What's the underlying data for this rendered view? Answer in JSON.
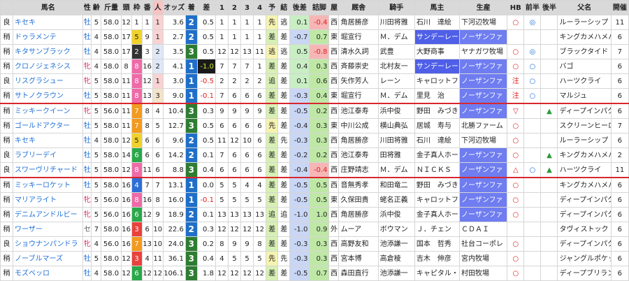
{
  "headers": [
    "馬名",
    "性",
    "齢",
    "斤量",
    "頭",
    "枠",
    "番",
    "人",
    "オッズ",
    "着",
    "差",
    "1",
    "2",
    "3",
    "4",
    "予",
    "結",
    "後差",
    "詰脚",
    "屋",
    "厩舎",
    "騎手",
    "馬主",
    "生産",
    "HB",
    "前半",
    "後半",
    "父名",
    "開催"
  ],
  "rows": [
    {
      "c": "良",
      "n": "キセキ",
      "s": "牡",
      "a": "5",
      "kg": "58.0",
      "h": "12",
      "w": "1",
      "u": "1",
      "p": "1",
      "o": "3.6",
      "f": "2",
      "d": "0.5",
      "c1": "1",
      "c2": "1",
      "c3": "1",
      "c4": "1",
      "y": "先",
      "k": "逃",
      "kd": "0.1",
      "tz": "-0.4",
      "ya": "西",
      "tr": "角居勝彦",
      "jk": "川田将雅",
      "ow": "石川　達絵",
      "br": "下河辺牧場",
      "hb": "○",
      "zh": "◎",
      "kh": "",
      "sire": "ルーラーシップ",
      "kai": "11"
    },
    {
      "c": "稍",
      "n": "ドゥラメンテ",
      "s": "牡",
      "a": "4",
      "kg": "58.0",
      "h": "17",
      "w": "5",
      "u": "9",
      "p": "1",
      "o": "2.7",
      "f": "2",
      "d": "0.5",
      "c1": "1",
      "c2": "1",
      "c3": "1",
      "c4": "1",
      "y": "差",
      "k": "差",
      "kd": "-0.7",
      "tz": "0.7",
      "ya": "東",
      "tr": "堀宣行",
      "jk": "Ｍ．デム",
      "ow": "サンデーレー",
      "br": "ノーザンファ",
      "hb": "",
      "zh": "",
      "kh": "",
      "sire": "キングカメハメハ",
      "kai": "6"
    },
    {
      "c": "稍",
      "n": "キタサンブラック",
      "s": "牡",
      "a": "4",
      "kg": "58.0",
      "h": "17",
      "w": "2",
      "u": "3",
      "p": "2",
      "o": "3.5",
      "f": "3",
      "d": "0.5",
      "c1": "12",
      "c2": "12",
      "c3": "13",
      "c4": "11",
      "y": "逃",
      "k": "逃",
      "kd": "0.5",
      "tz": "-0.8",
      "ya": "西",
      "tr": "清水久詞",
      "jk": "武豊",
      "ow": "大野商事",
      "br": "ヤナガワ牧場",
      "hb": "○",
      "zh": "◎",
      "kh": "",
      "sire": "ブラックタイド",
      "kai": "7"
    },
    {
      "c": "稍",
      "n": "クロノジェネシス",
      "s": "牝",
      "a": "4",
      "kg": "58.0",
      "h": "8",
      "w": "8",
      "u": "16",
      "p": "2",
      "o": "4.1",
      "f": "1",
      "d": "-1.0",
      "c1": "7",
      "c2": "7",
      "c3": "7",
      "c4": "1",
      "y": "差",
      "k": "差",
      "kd": "0.4",
      "tz": "0.3",
      "ya": "西",
      "tr": "斉藤崇史",
      "jk": "北村友一",
      "ow": "サンデーレー",
      "br": "ノーザンファ",
      "hb": "○",
      "zh": "○",
      "kh": "",
      "sire": "バゴ",
      "kai": "6"
    },
    {
      "c": "良",
      "n": "リスグラシュー",
      "s": "牝",
      "a": "5",
      "kg": "58.0",
      "h": "11",
      "w": "8",
      "u": "12",
      "p": "1",
      "o": "3.0",
      "f": "1",
      "d": "-0.5",
      "c1": "2",
      "c2": "2",
      "c3": "2",
      "c4": "2",
      "y": "追",
      "k": "差",
      "kd": "0.1",
      "tz": "0.6",
      "ya": "西",
      "tr": "矢作芳人",
      "jk": "レーン",
      "ow": "キャロットフ",
      "br": "ノーザンファ",
      "hb": "注",
      "zh": "○",
      "kh": "",
      "sire": "ハーツクライ",
      "kai": "6"
    },
    {
      "c": "稍",
      "n": "サトノクラウン",
      "s": "牡",
      "a": "5",
      "kg": "58.0",
      "h": "11",
      "w": "8",
      "u": "13",
      "p": "3",
      "o": "9.0",
      "f": "1",
      "d": "-0.1",
      "c1": "7",
      "c2": "6",
      "c3": "6",
      "c4": "6",
      "y": "差",
      "k": "差",
      "kd": "-0.3",
      "tz": "0.4",
      "ya": "東",
      "tr": "堀宣行",
      "jk": "Ｍ．デム",
      "ow": "里見　治",
      "br": "ノーザンファ",
      "hb": "注",
      "zh": "○",
      "kh": "",
      "sire": "マルジュ",
      "kai": "6"
    },
    {
      "c": "稍",
      "n": "ミッキークイーン",
      "s": "牝",
      "a": "5",
      "kg": "56.0",
      "h": "11",
      "w": "7",
      "u": "8",
      "p": "4",
      "o": "10.4",
      "f": "3",
      "d": "0.3",
      "c1": "9",
      "c2": "9",
      "c3": "9",
      "c4": "9",
      "y": "差",
      "k": "差",
      "kd": "-0.5",
      "tz": "0.2",
      "ya": "西",
      "tr": "池江泰寿",
      "jk": "浜中俊",
      "ow": "野田　みづき",
      "br": "ノーザンファ",
      "hb": "▽",
      "zh": "",
      "kh": "▲",
      "sire": "ディープインパクト",
      "kai": "6"
    },
    {
      "c": "稍",
      "n": "ゴールドアクター",
      "s": "牡",
      "a": "5",
      "kg": "58.0",
      "h": "11",
      "w": "7",
      "u": "8",
      "p": "5",
      "o": "12.7",
      "f": "3",
      "d": "0.5",
      "c1": "6",
      "c2": "6",
      "c3": "6",
      "c4": "6",
      "y": "先",
      "k": "差",
      "kd": "-0.4",
      "tz": "0.3",
      "ya": "東",
      "tr": "中川公成",
      "jk": "横山典弘",
      "ow": "居城　寿与",
      "br": "北勝ファーム",
      "hb": "○",
      "zh": "",
      "kh": "",
      "sire": "スクリーンヒーロー",
      "kai": "7"
    },
    {
      "c": "稍",
      "n": "キセキ",
      "s": "牡",
      "a": "4",
      "kg": "58.0",
      "h": "12",
      "w": "5",
      "u": "6",
      "p": "6",
      "o": "9.6",
      "f": "2",
      "d": "0.5",
      "c1": "11",
      "c2": "12",
      "c3": "10",
      "c4": "6",
      "y": "差",
      "k": "先",
      "kd": "-0.3",
      "tz": "0.3",
      "ya": "西",
      "tr": "角居勝彦",
      "jk": "川田将雅",
      "ow": "石川　達絵",
      "br": "下河辺牧場",
      "hb": "○",
      "zh": "",
      "kh": "",
      "sire": "ルーラーシップ",
      "kai": "6"
    },
    {
      "c": "良",
      "n": "ラブリーデイ",
      "s": "牡",
      "a": "5",
      "kg": "58.0",
      "h": "14",
      "w": "6",
      "u": "6",
      "p": "6",
      "o": "14.2",
      "f": "2",
      "d": "0.1",
      "c1": "7",
      "c2": "6",
      "c3": "6",
      "c4": "6",
      "y": "差",
      "k": "差",
      "kd": "-0.2",
      "tz": "0.2",
      "ya": "西",
      "tr": "池江泰寿",
      "jk": "田将雅",
      "ow": "金子真人ホー",
      "br": "ノーザンファ",
      "hb": "○",
      "zh": "",
      "kh": "▲",
      "sire": "キングカメハメハ",
      "kai": "2"
    },
    {
      "c": "良",
      "n": "スワーヴリチャード",
      "s": "牡",
      "a": "5",
      "kg": "58.0",
      "h": "12",
      "w": "8",
      "u": "11",
      "p": "6",
      "o": "8.8",
      "f": "3",
      "d": "0.4",
      "c1": "6",
      "c2": "6",
      "c3": "6",
      "c4": "6",
      "y": "差",
      "k": "差",
      "kd": "-0.4",
      "tz": "-0.4",
      "ya": "西",
      "tr": "庄野靖志",
      "jk": "Ｍ．デム",
      "ow": "ＮＩＣＫＳ",
      "br": "ノーザンファ",
      "hb": "△",
      "zh": "○",
      "kh": "▲",
      "sire": "ハーツクライ",
      "kai": "11"
    },
    {
      "c": "稍",
      "n": "ミッキーロケット",
      "s": "牡",
      "a": "5",
      "kg": "58.0",
      "h": "16",
      "w": "4",
      "u": "7",
      "p": "7",
      "o": "13.1",
      "f": "1",
      "d": "0.0",
      "c1": "5",
      "c2": "5",
      "c3": "4",
      "c4": "4",
      "y": "差",
      "k": "差",
      "kd": "-0.5",
      "tz": "0.5",
      "ya": "西",
      "tr": "音無秀孝",
      "jk": "和田竜二",
      "ow": "野田　みづき",
      "br": "ノーザンファ",
      "hb": "○",
      "zh": "",
      "kh": "",
      "sire": "キングカメハメハ",
      "kai": "6"
    },
    {
      "c": "稍",
      "n": "マリアライト",
      "s": "牝",
      "a": "5",
      "kg": "56.0",
      "h": "16",
      "w": "8",
      "u": "16",
      "p": "8",
      "o": "16.0",
      "f": "1",
      "d": "-0.1",
      "c1": "5",
      "c2": "5",
      "c3": "5",
      "c4": "5",
      "y": "差",
      "k": "差",
      "kd": "-0.5",
      "tz": "0.5",
      "ya": "東",
      "tr": "久保田貴",
      "jk": "蛯名正義",
      "ow": "キャロットフ",
      "br": "ノーザンファ",
      "hb": "○",
      "zh": "",
      "kh": "",
      "sire": "ディープインパクト",
      "kai": "6"
    },
    {
      "c": "稍",
      "n": "デニムアンドルビー",
      "s": "牝",
      "a": "5",
      "kg": "56.0",
      "h": "16",
      "w": "6",
      "u": "12",
      "p": "9",
      "o": "18.9",
      "f": "2",
      "d": "0.1",
      "c1": "13",
      "c2": "13",
      "c3": "13",
      "c4": "13",
      "y": "追",
      "k": "追",
      "kd": "-1.0",
      "tz": "1.0",
      "ya": "西",
      "tr": "角居勝彦",
      "jk": "浜中俊",
      "ow": "金子真人ホー",
      "br": "ノーザンファ",
      "hb": "○",
      "zh": "",
      "kh": "",
      "sire": "ディープインパクト",
      "kai": "6"
    },
    {
      "c": "稍",
      "n": "ワーザー",
      "s": "セ",
      "a": "7",
      "kg": "58.0",
      "h": "16",
      "w": "3",
      "u": "6",
      "p": "10",
      "o": "22.6",
      "f": "2",
      "d": "0.3",
      "c1": "12",
      "c2": "12",
      "c3": "12",
      "c4": "12",
      "y": "差",
      "k": "差",
      "kd": "-1.0",
      "tz": "0.9",
      "ya": "外",
      "tr": "ムーア",
      "jk": "ボウマン",
      "ow": "Ｊ．チェン",
      "br": "ＣＤＡＩ",
      "hb": "",
      "zh": "",
      "kh": "",
      "sire": "タヴィストック",
      "kai": "6"
    },
    {
      "c": "良",
      "n": "ショウナンパンドラ",
      "s": "牝",
      "a": "4",
      "kg": "56.0",
      "h": "16",
      "w": "7",
      "u": "13",
      "p": "10",
      "o": "24.0",
      "f": "3",
      "d": "0.2",
      "c1": "8",
      "c2": "9",
      "c3": "9",
      "c4": "8",
      "y": "差",
      "k": "差",
      "kd": "-0.3",
      "tz": "0.3",
      "ya": "西",
      "tr": "高野友和",
      "jk": "池添謙一",
      "ow": "国本　哲秀",
      "br": "社台コーポレ",
      "hb": "○",
      "zh": "",
      "kh": "",
      "sire": "ディープインパクト",
      "kai": "6"
    },
    {
      "c": "稍",
      "n": "ノーブルマーズ",
      "s": "牡",
      "a": "5",
      "kg": "58.0",
      "h": "12",
      "w": "3",
      "u": "4",
      "p": "11",
      "o": "36.1",
      "f": "3",
      "d": "0.4",
      "c1": "4",
      "c2": "5",
      "c3": "5",
      "c4": "5",
      "y": "先",
      "k": "先",
      "kd": "-0.3",
      "tz": "0.3",
      "ya": "西",
      "tr": "宮本博",
      "jk": "高倉稜",
      "ow": "吉木　伸彦",
      "br": "宮内牧場",
      "hb": "○",
      "zh": "",
      "kh": "",
      "sire": "ジャングルポケット",
      "kai": "6"
    },
    {
      "c": "稍",
      "n": "モズベッロ",
      "s": "牡",
      "a": "4",
      "kg": "58.0",
      "h": "12",
      "w": "6",
      "u": "12",
      "p": "12",
      "o": "106.1",
      "f": "3",
      "d": "1.8",
      "c1": "12",
      "c2": "12",
      "c3": "12",
      "c4": "12",
      "y": "差",
      "k": "差",
      "kd": "-0.5",
      "tz": "0.7",
      "ya": "西",
      "tr": "森田直行",
      "jk": "池添謙一",
      "ow": "キャピタル・",
      "br": "村田牧場",
      "hb": "○",
      "zh": "",
      "kh": "",
      "sire": "ディープブリランテ",
      "kai": "6"
    }
  ]
}
